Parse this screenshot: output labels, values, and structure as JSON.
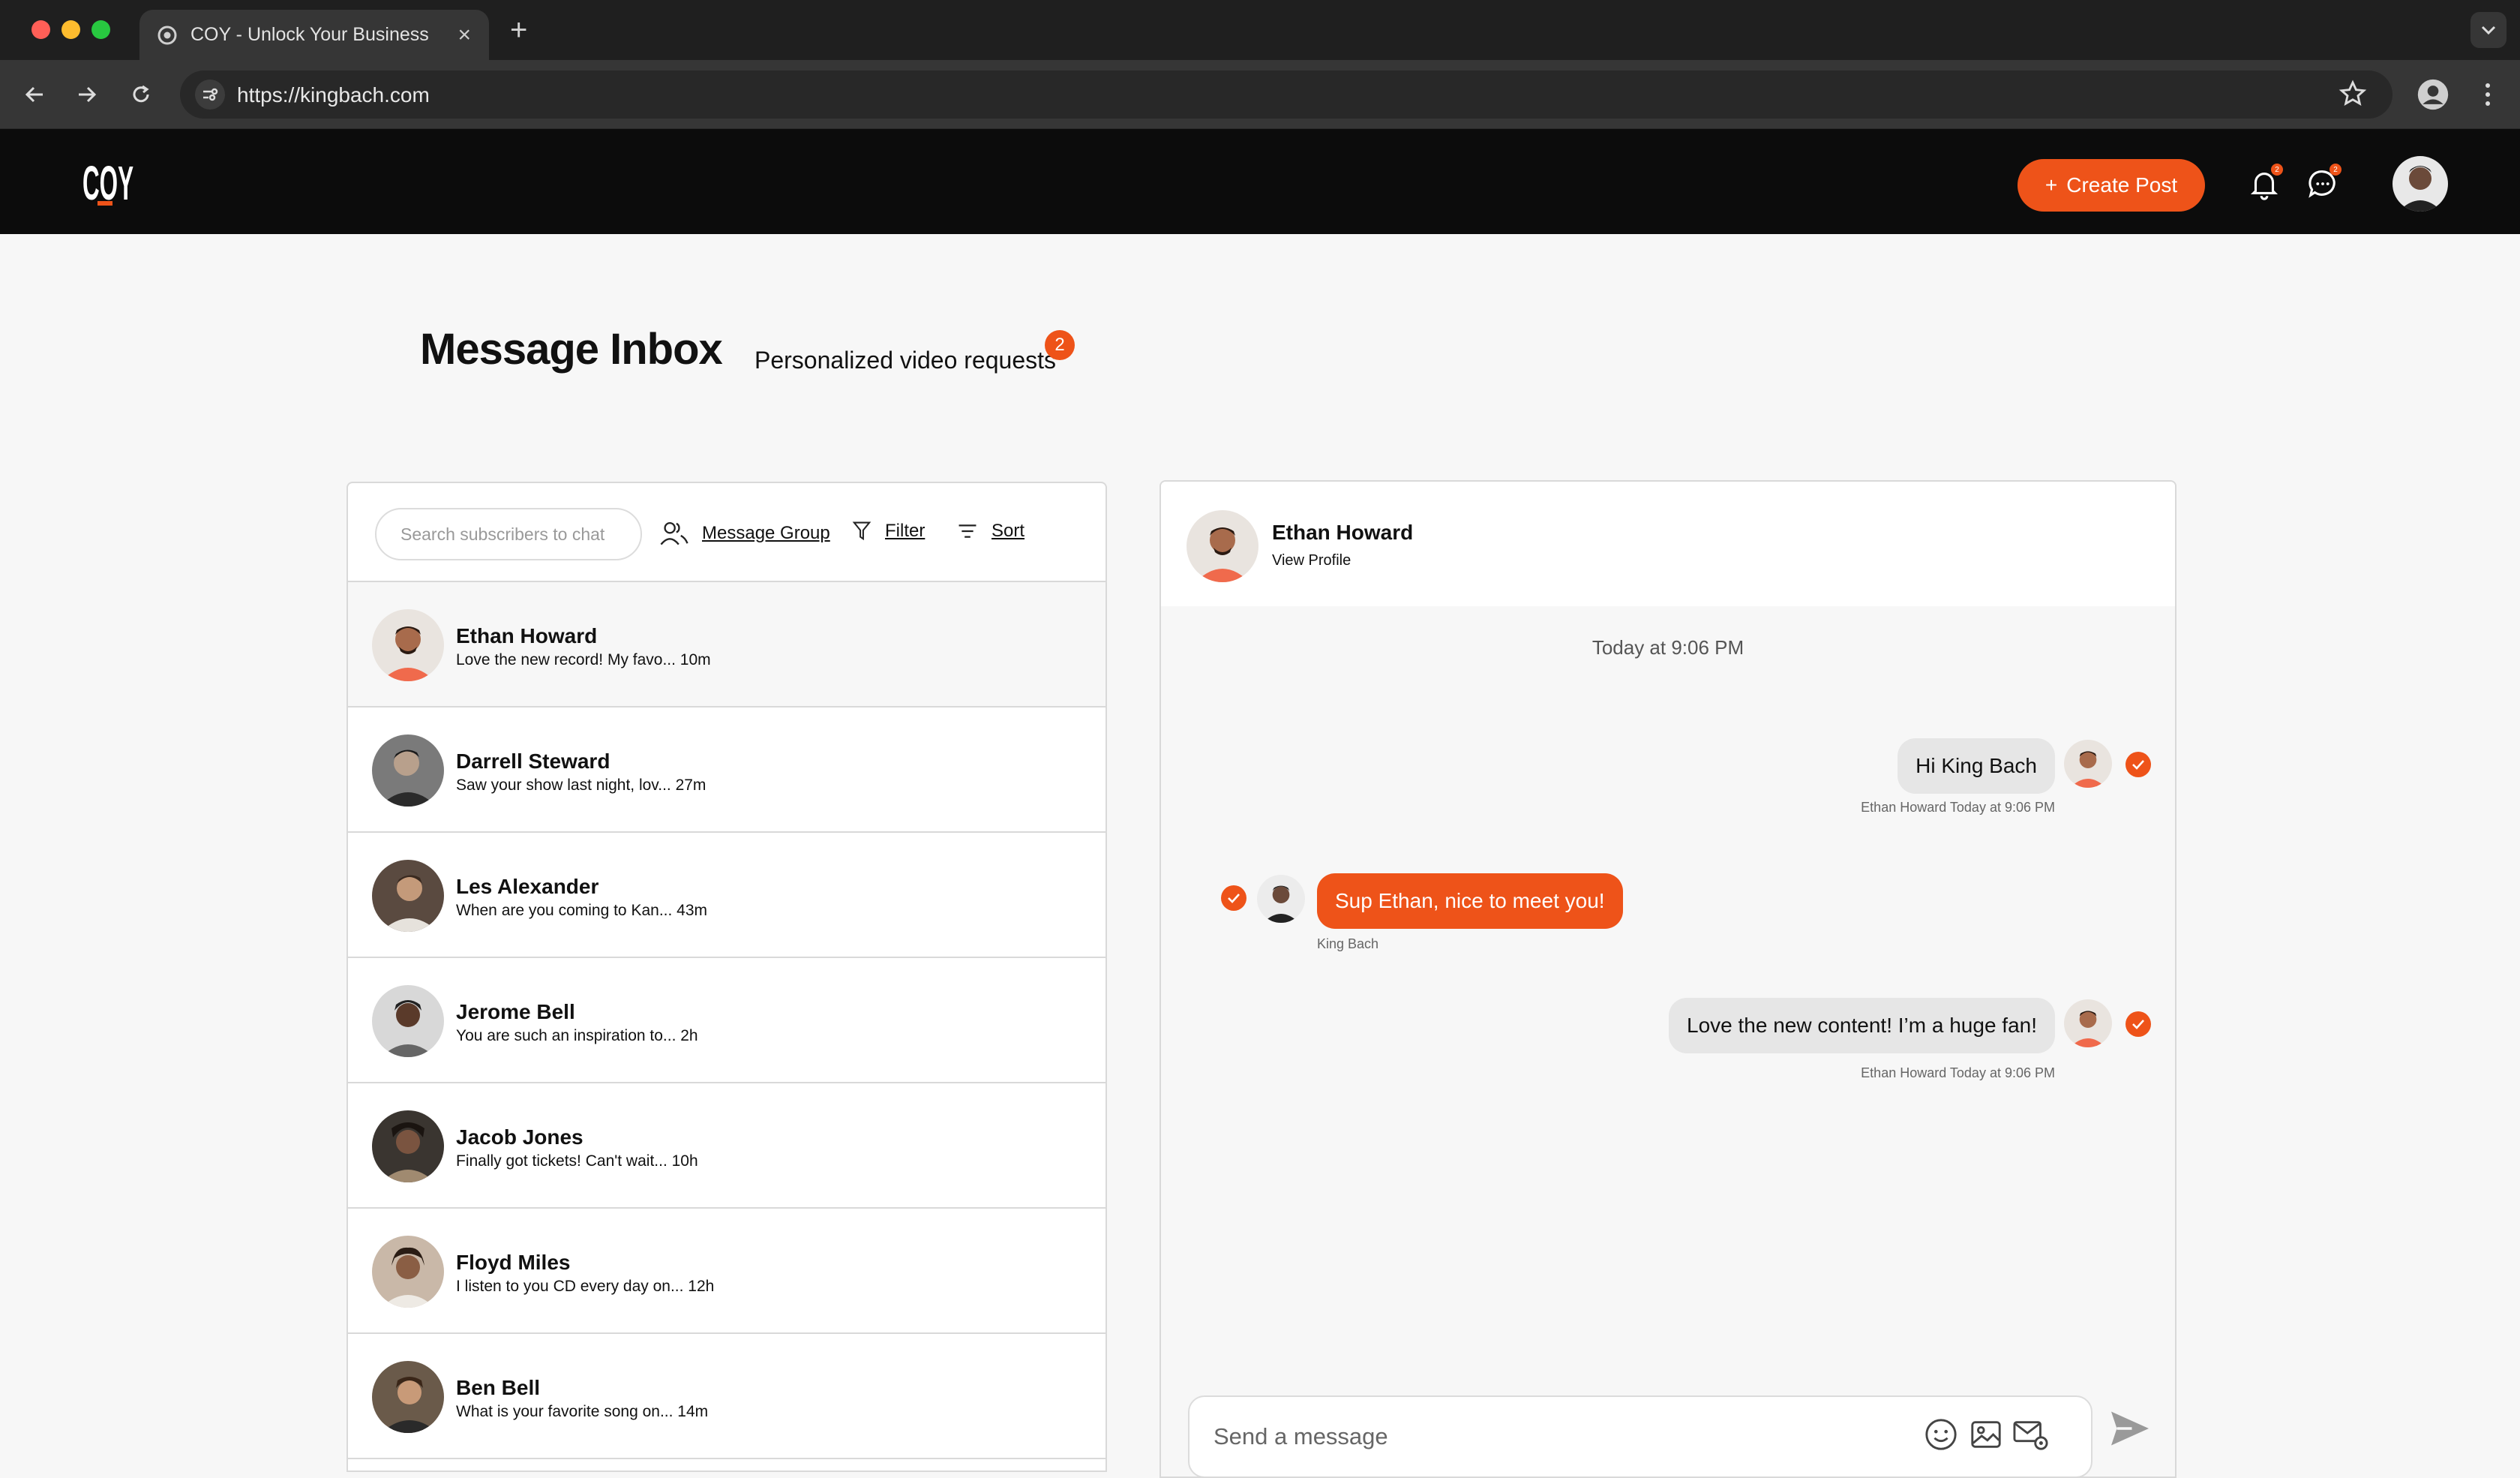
{
  "browser": {
    "tab_title": "COY - Unlock Your Business",
    "url": "https://kingbach.com"
  },
  "header": {
    "logo_text": "COY",
    "create_post_label": "Create Post",
    "notification_badge": "2",
    "messages_badge": "2",
    "accent_color": "#ee5319"
  },
  "page": {
    "title": "Message Inbox",
    "video_requests_label": "Personalized video requests",
    "video_requests_count": "2"
  },
  "toolbar": {
    "search_placeholder": "Search subscribers to chat",
    "message_group_label": "Message Group",
    "filter_label": "Filter",
    "sort_label": "Sort"
  },
  "conversations": [
    {
      "name": "Ethan Howard",
      "preview": "Love the new record! My favo... 10m"
    },
    {
      "name": "Darrell Steward",
      "preview": "Saw your show last night, lov... 27m"
    },
    {
      "name": "Les Alexander",
      "preview": "When are you coming to Kan... 43m"
    },
    {
      "name": "Jerome Bell",
      "preview": "You are such an inspiration to... 2h"
    },
    {
      "name": "Jacob Jones",
      "preview": "Finally got tickets! Can't wait... 10h"
    },
    {
      "name": "Floyd Miles",
      "preview": "I listen to you CD every day on... 12h"
    },
    {
      "name": "Ben Bell",
      "preview": "What is your favorite song on... 14m"
    }
  ],
  "chat": {
    "contact_name": "Ethan Howard",
    "view_profile_label": "View Profile",
    "timestamp": "Today at 9:06 PM",
    "messages": [
      {
        "text": "Hi King Bach",
        "meta": "Ethan Howard Today at 9:06 PM"
      },
      {
        "text": "Sup Ethan, nice to meet you!",
        "meta": "King Bach"
      },
      {
        "text": "Love the new content! I’m a huge fan!",
        "meta": "Ethan Howard Today at 9:06 PM"
      }
    ],
    "composer_placeholder": "Send a message"
  }
}
